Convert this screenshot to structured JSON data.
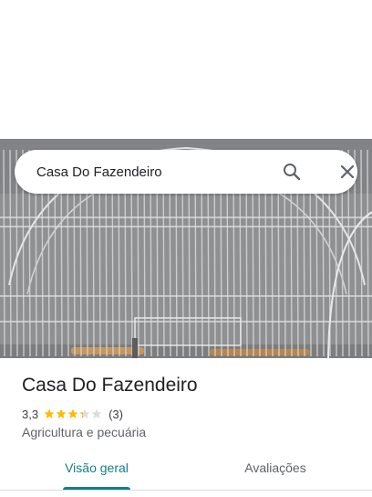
{
  "search": {
    "value": "Casa Do Fazendeiro",
    "search_icon": "search-icon",
    "close_icon": "close-icon"
  },
  "hero_photo": {
    "description_icon": "birdcage-photo"
  },
  "place": {
    "name": "Casa Do Fazendeiro",
    "rating": "3,3",
    "rating_value": 3.3,
    "rating_max": 5,
    "reviews": "(3)",
    "category": "Agricultura e pecuária"
  },
  "tabs": [
    {
      "label": "Visão geral",
      "active": true
    },
    {
      "label": "Avaliações",
      "active": false
    }
  ],
  "colors": {
    "accent": "#137e8c",
    "star": "#fbbc04",
    "star_empty": "#dadce0"
  }
}
